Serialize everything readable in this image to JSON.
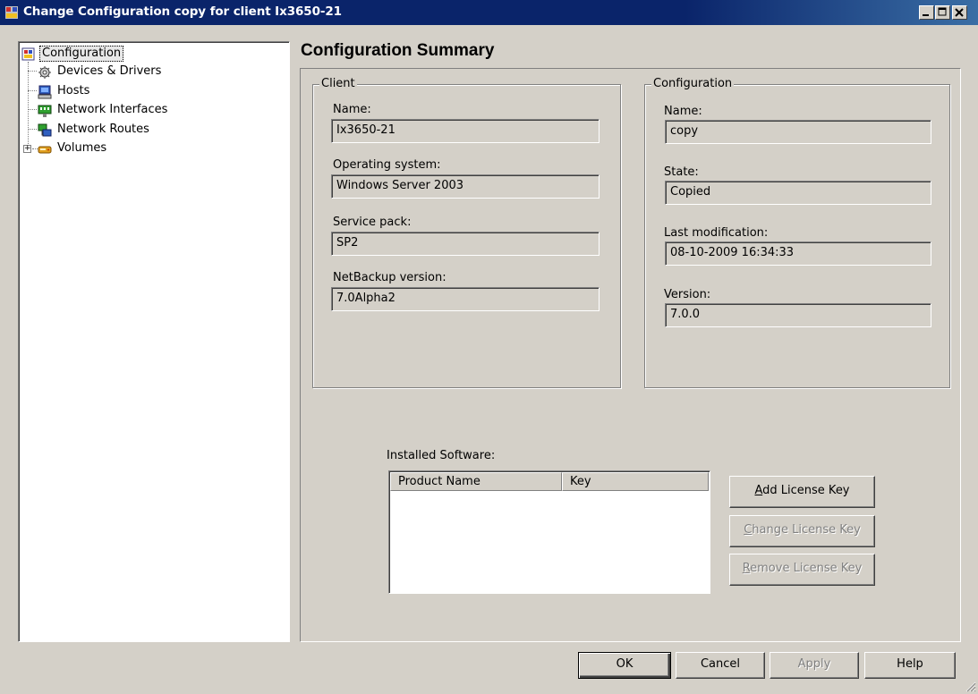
{
  "window": {
    "title": "Change Configuration copy for client Ix3650-21",
    "controls": [
      "minimize",
      "maximize",
      "close"
    ]
  },
  "tree": {
    "root": {
      "label": "Configuration",
      "icon": "configuration-icon"
    },
    "items": [
      {
        "label": "Devices & Drivers",
        "icon": "devices-drivers-icon"
      },
      {
        "label": "Hosts",
        "icon": "hosts-icon"
      },
      {
        "label": "Network Interfaces",
        "icon": "network-interfaces-icon"
      },
      {
        "label": "Network Routes",
        "icon": "network-routes-icon"
      },
      {
        "label": "Volumes",
        "icon": "volumes-icon",
        "expandable": true
      }
    ]
  },
  "summary": {
    "title": "Configuration Summary",
    "client": {
      "legend": "Client",
      "fields": [
        {
          "label": "Name:",
          "value": "Ix3650-21"
        },
        {
          "label": "Operating system:",
          "value": "Windows Server 2003"
        },
        {
          "label": "Service pack:",
          "value": "SP2"
        },
        {
          "label": "NetBackup version:",
          "value": "7.0Alpha2"
        }
      ]
    },
    "configuration": {
      "legend": "Configuration",
      "fields": [
        {
          "label": "Name:",
          "value": "copy"
        },
        {
          "label": "State:",
          "value": "Copied"
        },
        {
          "label": "Last modification:",
          "value": "08-10-2009 16:34:33"
        },
        {
          "label": "Version:",
          "value": "7.0.0"
        }
      ]
    },
    "software": {
      "label": "Installed Software:",
      "columns": [
        "Product Name",
        "Key"
      ],
      "rows": []
    },
    "buttons": {
      "add": {
        "pre": "",
        "u": "A",
        "post": "dd License Key"
      },
      "change": {
        "pre": "",
        "u": "C",
        "post": "hange License Key"
      },
      "remove": {
        "pre": "",
        "u": "R",
        "post": "emove License Key"
      }
    }
  },
  "footer": {
    "ok": "OK",
    "cancel": "Cancel",
    "apply": "Apply",
    "help": "Help"
  }
}
